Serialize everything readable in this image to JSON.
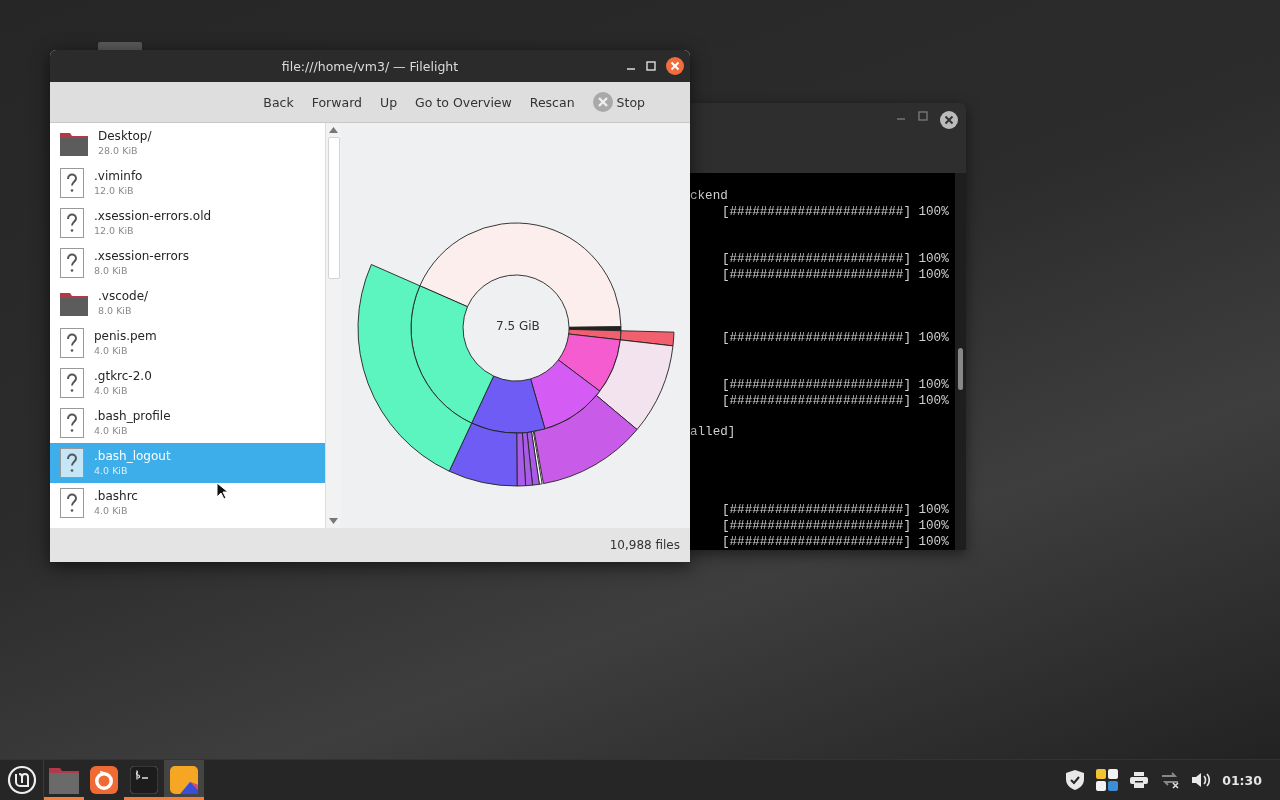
{
  "filelight": {
    "title": "file:///home/vm3/ — Filelight",
    "toolbar": [
      {
        "label": "Back",
        "kind": "text"
      },
      {
        "label": "Forward",
        "kind": "text"
      },
      {
        "label": "Up",
        "kind": "text"
      },
      {
        "label": "Go to Overview",
        "kind": "text"
      },
      {
        "label": "Rescan",
        "kind": "text"
      },
      {
        "label": "Stop",
        "kind": "stop"
      }
    ],
    "files": [
      {
        "name": "Desktop/",
        "size": "28.0 KiB",
        "kind": "folder",
        "selected": false
      },
      {
        "name": ".viminfo",
        "size": "12.0 KiB",
        "kind": "file",
        "selected": false
      },
      {
        "name": ".xsession-errors.old",
        "size": "12.0 KiB",
        "kind": "file",
        "selected": false
      },
      {
        "name": ".xsession-errors",
        "size": "8.0 KiB",
        "kind": "file",
        "selected": false
      },
      {
        "name": ".vscode/",
        "size": "8.0 KiB",
        "kind": "folder",
        "selected": false
      },
      {
        "name": "penis.pem",
        "size": "4.0 KiB",
        "kind": "file",
        "selected": false
      },
      {
        "name": ".gtkrc-2.0",
        "size": "4.0 KiB",
        "kind": "file",
        "selected": false
      },
      {
        "name": ".bash_profile",
        "size": "4.0 KiB",
        "kind": "file",
        "selected": false
      },
      {
        "name": ".bash_logout",
        "size": "4.0 KiB",
        "kind": "file",
        "selected": true
      },
      {
        "name": ".bashrc",
        "size": "4.0 KiB",
        "kind": "file",
        "selected": false
      }
    ],
    "chart_center": "7.5 GiB",
    "status": "10,988 files"
  },
  "terminal": {
    "lines": [
      {
        "kind": "text",
        "text": "ckend"
      },
      {
        "kind": "progress",
        "text": "[#######################] 100%"
      },
      {
        "kind": "blank"
      },
      {
        "kind": "blank"
      },
      {
        "kind": "progress",
        "text": "[#######################] 100%"
      },
      {
        "kind": "progress",
        "text": "[#######################] 100%"
      },
      {
        "kind": "blank"
      },
      {
        "kind": "blank"
      },
      {
        "kind": "blank"
      },
      {
        "kind": "progress",
        "text": "[#######################] 100%"
      },
      {
        "kind": "blank"
      },
      {
        "kind": "blank"
      },
      {
        "kind": "progress",
        "text": "[#######################] 100%"
      },
      {
        "kind": "progress",
        "text": "[#######################] 100%"
      },
      {
        "kind": "blank"
      },
      {
        "kind": "text",
        "text": "alled]"
      },
      {
        "kind": "blank"
      },
      {
        "kind": "blank"
      },
      {
        "kind": "blank"
      },
      {
        "kind": "blank"
      },
      {
        "kind": "progress",
        "text": "[#######################] 100%"
      },
      {
        "kind": "progress",
        "text": "[#######################] 100%"
      },
      {
        "kind": "progress",
        "text": "[#######################] 100%"
      }
    ]
  },
  "taskbar": {
    "apps": [
      {
        "kind": "files",
        "running": true,
        "selected": false
      },
      {
        "kind": "firefox",
        "running": false,
        "selected": false
      },
      {
        "kind": "terminal",
        "running": true,
        "selected": false
      },
      {
        "kind": "filelight",
        "running": true,
        "selected": true
      }
    ],
    "tray": [
      {
        "kind": "shield"
      },
      {
        "kind": "updates"
      },
      {
        "kind": "printer"
      },
      {
        "kind": "network"
      },
      {
        "kind": "volume"
      }
    ],
    "clock": "01:30"
  }
}
